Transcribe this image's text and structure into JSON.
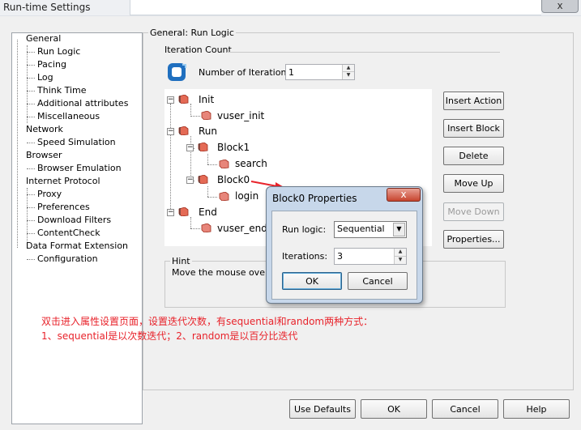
{
  "window": {
    "title": "Run-time Settings",
    "close_glyph": "x"
  },
  "left_tree": {
    "items": [
      {
        "label": "General"
      },
      {
        "label": "Run Logic"
      },
      {
        "label": "Pacing"
      },
      {
        "label": "Log"
      },
      {
        "label": "Think Time"
      },
      {
        "label": "Additional attributes"
      },
      {
        "label": "Miscellaneous"
      },
      {
        "label": "Network"
      },
      {
        "label": "Speed Simulation"
      },
      {
        "label": "Browser"
      },
      {
        "label": "Browser Emulation"
      },
      {
        "label": "Internet Protocol"
      },
      {
        "label": "Proxy"
      },
      {
        "label": "Preferences"
      },
      {
        "label": "Download Filters"
      },
      {
        "label": "ContentCheck"
      },
      {
        "label": "Data Format Extension"
      },
      {
        "label": "Configuration"
      }
    ]
  },
  "main": {
    "group_title": "General: Run Logic",
    "iteration_count_label": "Iteration Count",
    "number_of_iterations_label": "Number of Iterations:",
    "number_of_iterations_value": "1",
    "tree": {
      "init": "Init",
      "vuser_init": "vuser_init",
      "run": "Run",
      "block1": "Block1",
      "search": "search",
      "block0": "Block0",
      "login": "login",
      "end": "End",
      "vuser_end": "vuser_end"
    },
    "buttons": {
      "insert_action": "Insert Action",
      "insert_block": "Insert Block",
      "delete": "Delete",
      "move_up": "Move Up",
      "move_down": "Move Down",
      "properties": "Properties..."
    },
    "hint_label": "Hint",
    "hint_text": "Move the mouse over an"
  },
  "annotation": {
    "line1": "双击进入属性设置页面，设置迭代次数，有sequential和random两种方式：",
    "line2": "1、sequential是以次数迭代；2、random是以百分比迭代",
    "color": "#e8232b"
  },
  "dialog": {
    "title": "Block0 Properties",
    "close_glyph": "x",
    "run_logic_label": "Run logic:",
    "run_logic_value": "Sequential",
    "iterations_label": "Iterations:",
    "iterations_value": "3",
    "ok": "OK",
    "cancel": "Cancel"
  },
  "footer": {
    "use_defaults": "Use Defaults",
    "ok": "OK",
    "cancel": "Cancel",
    "help": "Help"
  }
}
